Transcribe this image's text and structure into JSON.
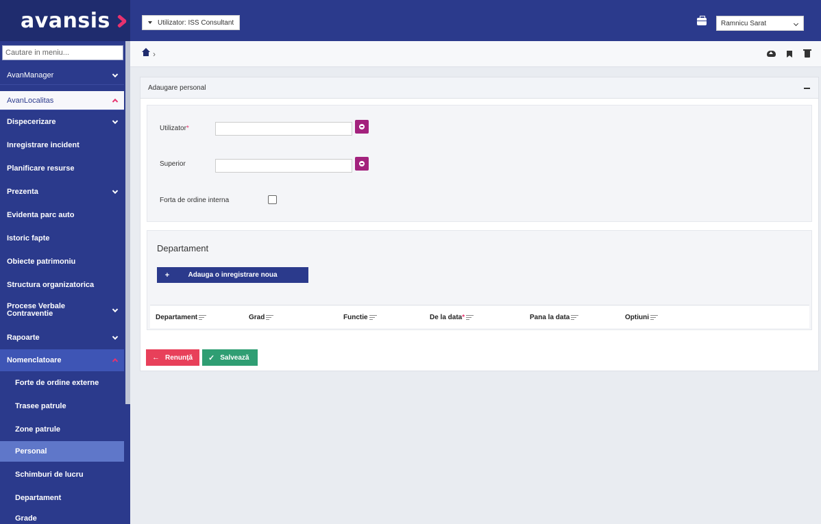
{
  "app": {
    "logo_text": "avansis",
    "accent_color": "#e8326e",
    "brand_color": "#2b3a8c"
  },
  "sidebar": {
    "search_placeholder": "Cautare in meniu...",
    "items": [
      {
        "label": "AvanManager"
      },
      {
        "label": "AvanLocalitas"
      },
      {
        "label": "Dispecerizare"
      },
      {
        "label": "Inregistrare incident"
      },
      {
        "label": "Planificare resurse"
      },
      {
        "label": "Prezenta"
      },
      {
        "label": "Evidenta parc auto"
      },
      {
        "label": "Istoric fapte"
      },
      {
        "label": "Obiecte patrimoniu"
      },
      {
        "label": "Structura organizatorica"
      },
      {
        "label": "Procese Verbale Contraventie"
      },
      {
        "label": "Rapoarte"
      },
      {
        "label": "Nomenclatoare"
      },
      {
        "label": "Forte de ordine externe"
      },
      {
        "label": "Trasee patrule"
      },
      {
        "label": "Zone patrule"
      },
      {
        "label": "Personal"
      },
      {
        "label": "Schimburi de lucru"
      },
      {
        "label": "Departament"
      },
      {
        "label": "Grade"
      }
    ]
  },
  "header": {
    "user_label": "Utilizator: ISS Consultant",
    "city": "Ramnicu Sarat"
  },
  "breadcrumb": {
    "separator": "›"
  },
  "form": {
    "title": "Adaugare personal",
    "utilizator_label": "Utilizator",
    "superior_label": "Superior",
    "forta_label": "Forta de ordine interna",
    "required_mark": "*"
  },
  "departament": {
    "title": "Departament",
    "add_label": "Adauga o inregistrare noua",
    "add_glyph": "+",
    "columns": [
      "Departament",
      "Grad",
      "Functie",
      "De la data",
      "Pana la data",
      "Optiuni"
    ]
  },
  "actions": {
    "cancel_label": "Renunță",
    "save_label": "Salvează",
    "cancel_glyph": "←",
    "save_glyph": "✓"
  }
}
